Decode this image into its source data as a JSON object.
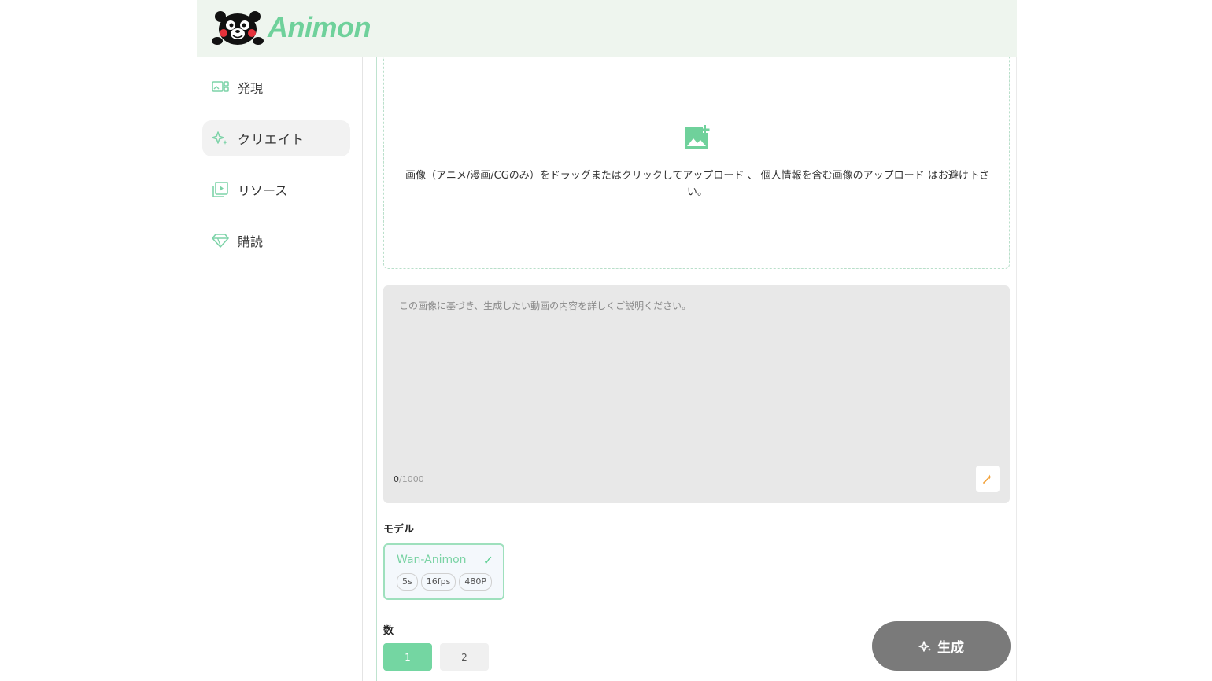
{
  "app": {
    "brand_name": "Animon",
    "colors": {
      "accent": "#6fd19b",
      "header_bg": "#eef5ee",
      "generate_button": "#7a7a7a",
      "prompt_bg": "#e8e8e8"
    }
  },
  "sidebar": {
    "items": [
      {
        "label": "発現",
        "icon": "discover-icon",
        "active": false
      },
      {
        "label": "クリエイト",
        "icon": "sparkle-icon",
        "active": true
      },
      {
        "label": "リソース",
        "icon": "video-library-icon",
        "active": false
      },
      {
        "label": "購読",
        "icon": "diamond-icon",
        "active": false
      }
    ]
  },
  "upload": {
    "icon": "add-image-icon",
    "instruction": "画像（アニメ/漫画/CGのみ）をドラッグまたはクリックしてアップロード 、 個人情報を含む画像のアップロード はお避け下さい。"
  },
  "prompt": {
    "placeholder": "この画像に基づき、生成したい動画の内容を詳しくご説明ください。",
    "value": "",
    "char_count": "0",
    "char_limit": "/1000",
    "magic_icon": "magic-wand-icon"
  },
  "model": {
    "section_label": "モデル",
    "selected": {
      "name": "Wan-Animon",
      "check": "✓",
      "tags": [
        "5s",
        "16fps",
        "480P"
      ]
    }
  },
  "count": {
    "section_label": "数",
    "options": [
      "1",
      "2"
    ],
    "selected": "1"
  },
  "generate": {
    "label": "生成",
    "icon": "sparkle-icon"
  }
}
